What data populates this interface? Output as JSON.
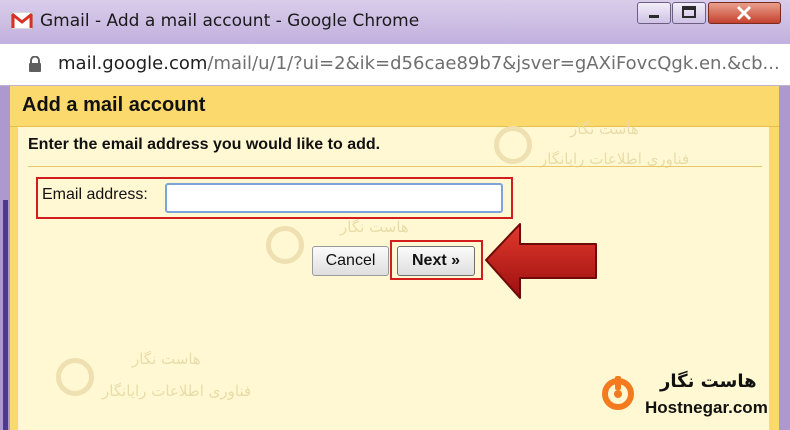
{
  "window": {
    "title": "Gmail - Add a mail account - Google Chrome",
    "gmail_icon": "gmail-m-icon",
    "controls": [
      "minimize",
      "maximize",
      "close"
    ]
  },
  "address_bar": {
    "domain": "mail.google.com",
    "path": "/mail/u/1/?ui=2&ik=d56cae89b7&jsver=gAXiFovcQgk.en.&cb..."
  },
  "dialog": {
    "title": "Add a mail account",
    "instruction": "Enter the email address you would like to add.",
    "email_label": "Email address:",
    "email_value": "",
    "cancel_label": "Cancel",
    "next_label": "Next »"
  },
  "colors": {
    "header_bg": "#fbd96c",
    "body_bg": "#fff8d2",
    "highlight": "#d21d1d",
    "arrow": "#c41818",
    "brand_orange": "#f47a20"
  },
  "watermark": {
    "brand_fa": "هاست نگار",
    "tagline_fa": "فناوری اطلاعات رایانگار"
  },
  "brand": {
    "name_fa": "هاست نگار",
    "name_en": "Hostnegar.com",
    "icon": "hostnegar-logo-icon"
  }
}
